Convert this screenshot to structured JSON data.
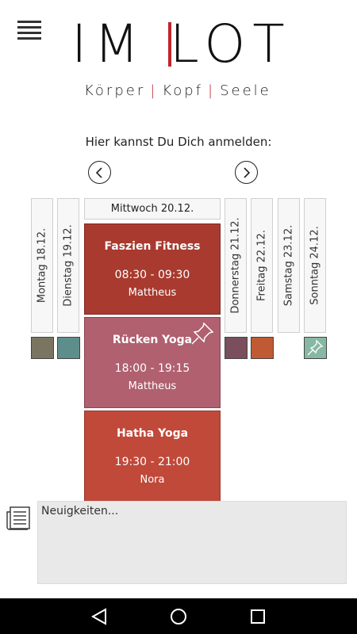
{
  "header": {
    "logo_text_left": "IM",
    "logo_text_right": "LOT",
    "tagline": [
      "Körper",
      "Kopf",
      "Seele"
    ],
    "tagline_separator": "|"
  },
  "prompt": "Hier kannst Du Dich anmelden:",
  "days": [
    {
      "label": "Montag  18.12.",
      "color": "#7a7560"
    },
    {
      "label": "Dienstag  19.12.",
      "color": "#5e8e8c"
    },
    {
      "label": "Donnerstag  21.12.",
      "color": "#7a4e5c"
    },
    {
      "label": "Freitag  22.12.",
      "color": "#c05a35"
    },
    {
      "label": "Samstag  23.12.",
      "color": null
    },
    {
      "label": "Sonntag  24.12.",
      "color": "#86b8a3"
    }
  ],
  "active_day": "Mittwoch  20.12.",
  "courses": [
    {
      "title": "Faszien Fitness",
      "time": "08:30 - 09:30",
      "teacher": "Mattheus",
      "color": "#a93a2f",
      "pinned": false
    },
    {
      "title": "Rücken Yoga",
      "time": "18:00 - 19:15",
      "teacher": "Mattheus",
      "color": "#b0606f",
      "pinned": true
    },
    {
      "title": "Hatha Yoga",
      "time": "19:30 - 21:00",
      "teacher": "Nora",
      "color": "#c0493a",
      "pinned": false
    }
  ],
  "news": {
    "placeholder": "Neuigkeiten..."
  },
  "colors": {
    "brand_accent": "#c0262e",
    "navbar": "#000000"
  },
  "icons": {
    "menu": "hamburger-icon",
    "prev": "chevron-left-icon",
    "next": "chevron-right-icon",
    "pin": "pushpin-icon",
    "news": "newspaper-icon",
    "back": "back-triangle-icon",
    "home": "home-circle-icon",
    "recents": "recents-square-icon"
  }
}
